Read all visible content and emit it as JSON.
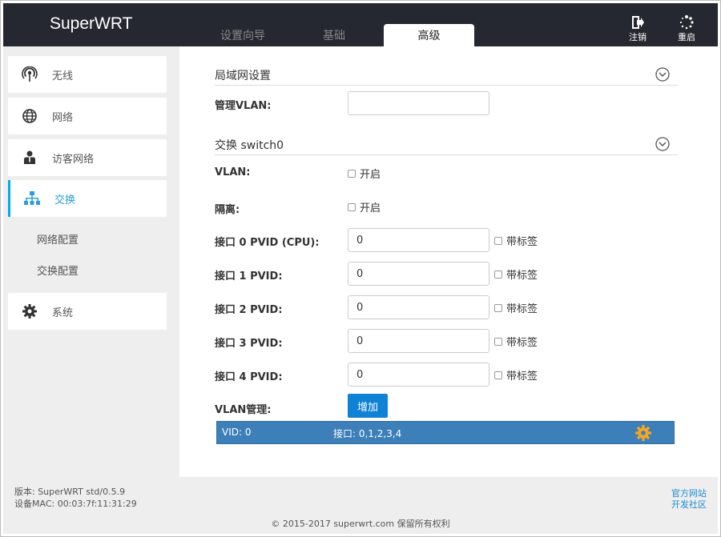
{
  "header": {
    "brand": "SuperWRT",
    "tabs": [
      {
        "label": "设置向导"
      },
      {
        "label": "基础"
      },
      {
        "label": "高级"
      }
    ],
    "active_tab": "高级",
    "logout_label": "注销",
    "reboot_label": "重启"
  },
  "sidebar": {
    "items": [
      {
        "label": "无线",
        "icon": "wireless-icon"
      },
      {
        "label": "网络",
        "icon": "globe-icon"
      },
      {
        "label": "访客网络",
        "icon": "guest-user-icon"
      },
      {
        "label": "交换",
        "icon": "network-tree-icon"
      },
      {
        "label": "系统",
        "icon": "gear-icon"
      }
    ],
    "subitems": [
      {
        "label": "网络配置"
      },
      {
        "label": "交换配置"
      }
    ]
  },
  "lan": {
    "title": "局域网设置",
    "mgmt_vlan_label": "管理VLAN:",
    "mgmt_vlan_value": ""
  },
  "switch": {
    "title": "交换 switch0",
    "vlan_label": "VLAN:",
    "vlan_check_label": "开启",
    "isolation_label": "隔离:",
    "isolation_check_label": "开启",
    "ports": [
      {
        "label": "接口 0 PVID (CPU):",
        "value": "0",
        "tag_label": "带标签"
      },
      {
        "label": "接口 1 PVID:",
        "value": "0",
        "tag_label": "带标签"
      },
      {
        "label": "接口 2 PVID:",
        "value": "0",
        "tag_label": "带标签"
      },
      {
        "label": "接口 3 PVID:",
        "value": "0",
        "tag_label": "带标签"
      },
      {
        "label": "接口 4 PVID:",
        "value": "0",
        "tag_label": "带标签"
      }
    ],
    "vlan_mgmt_label": "VLAN管理:",
    "add_button": "增加",
    "vlan_rows": [
      {
        "vid": "VID: 0",
        "ports": "接口: 0,1,2,3,4"
      }
    ]
  },
  "footer": {
    "version": "版本: SuperWRT std/0.5.9",
    "mac": "设备MAC: 00:03:7f:11:31:29",
    "official_site": "官方网站",
    "community": "开发社区",
    "copyright": "© 2015-2017 superwrt.com 保留所有权利"
  },
  "colors": {
    "topbar": "#252830",
    "accent": "#00aaee",
    "button": "#0f82d6",
    "vlan_row": "#3d7fb9",
    "gear": "#f5a623"
  }
}
